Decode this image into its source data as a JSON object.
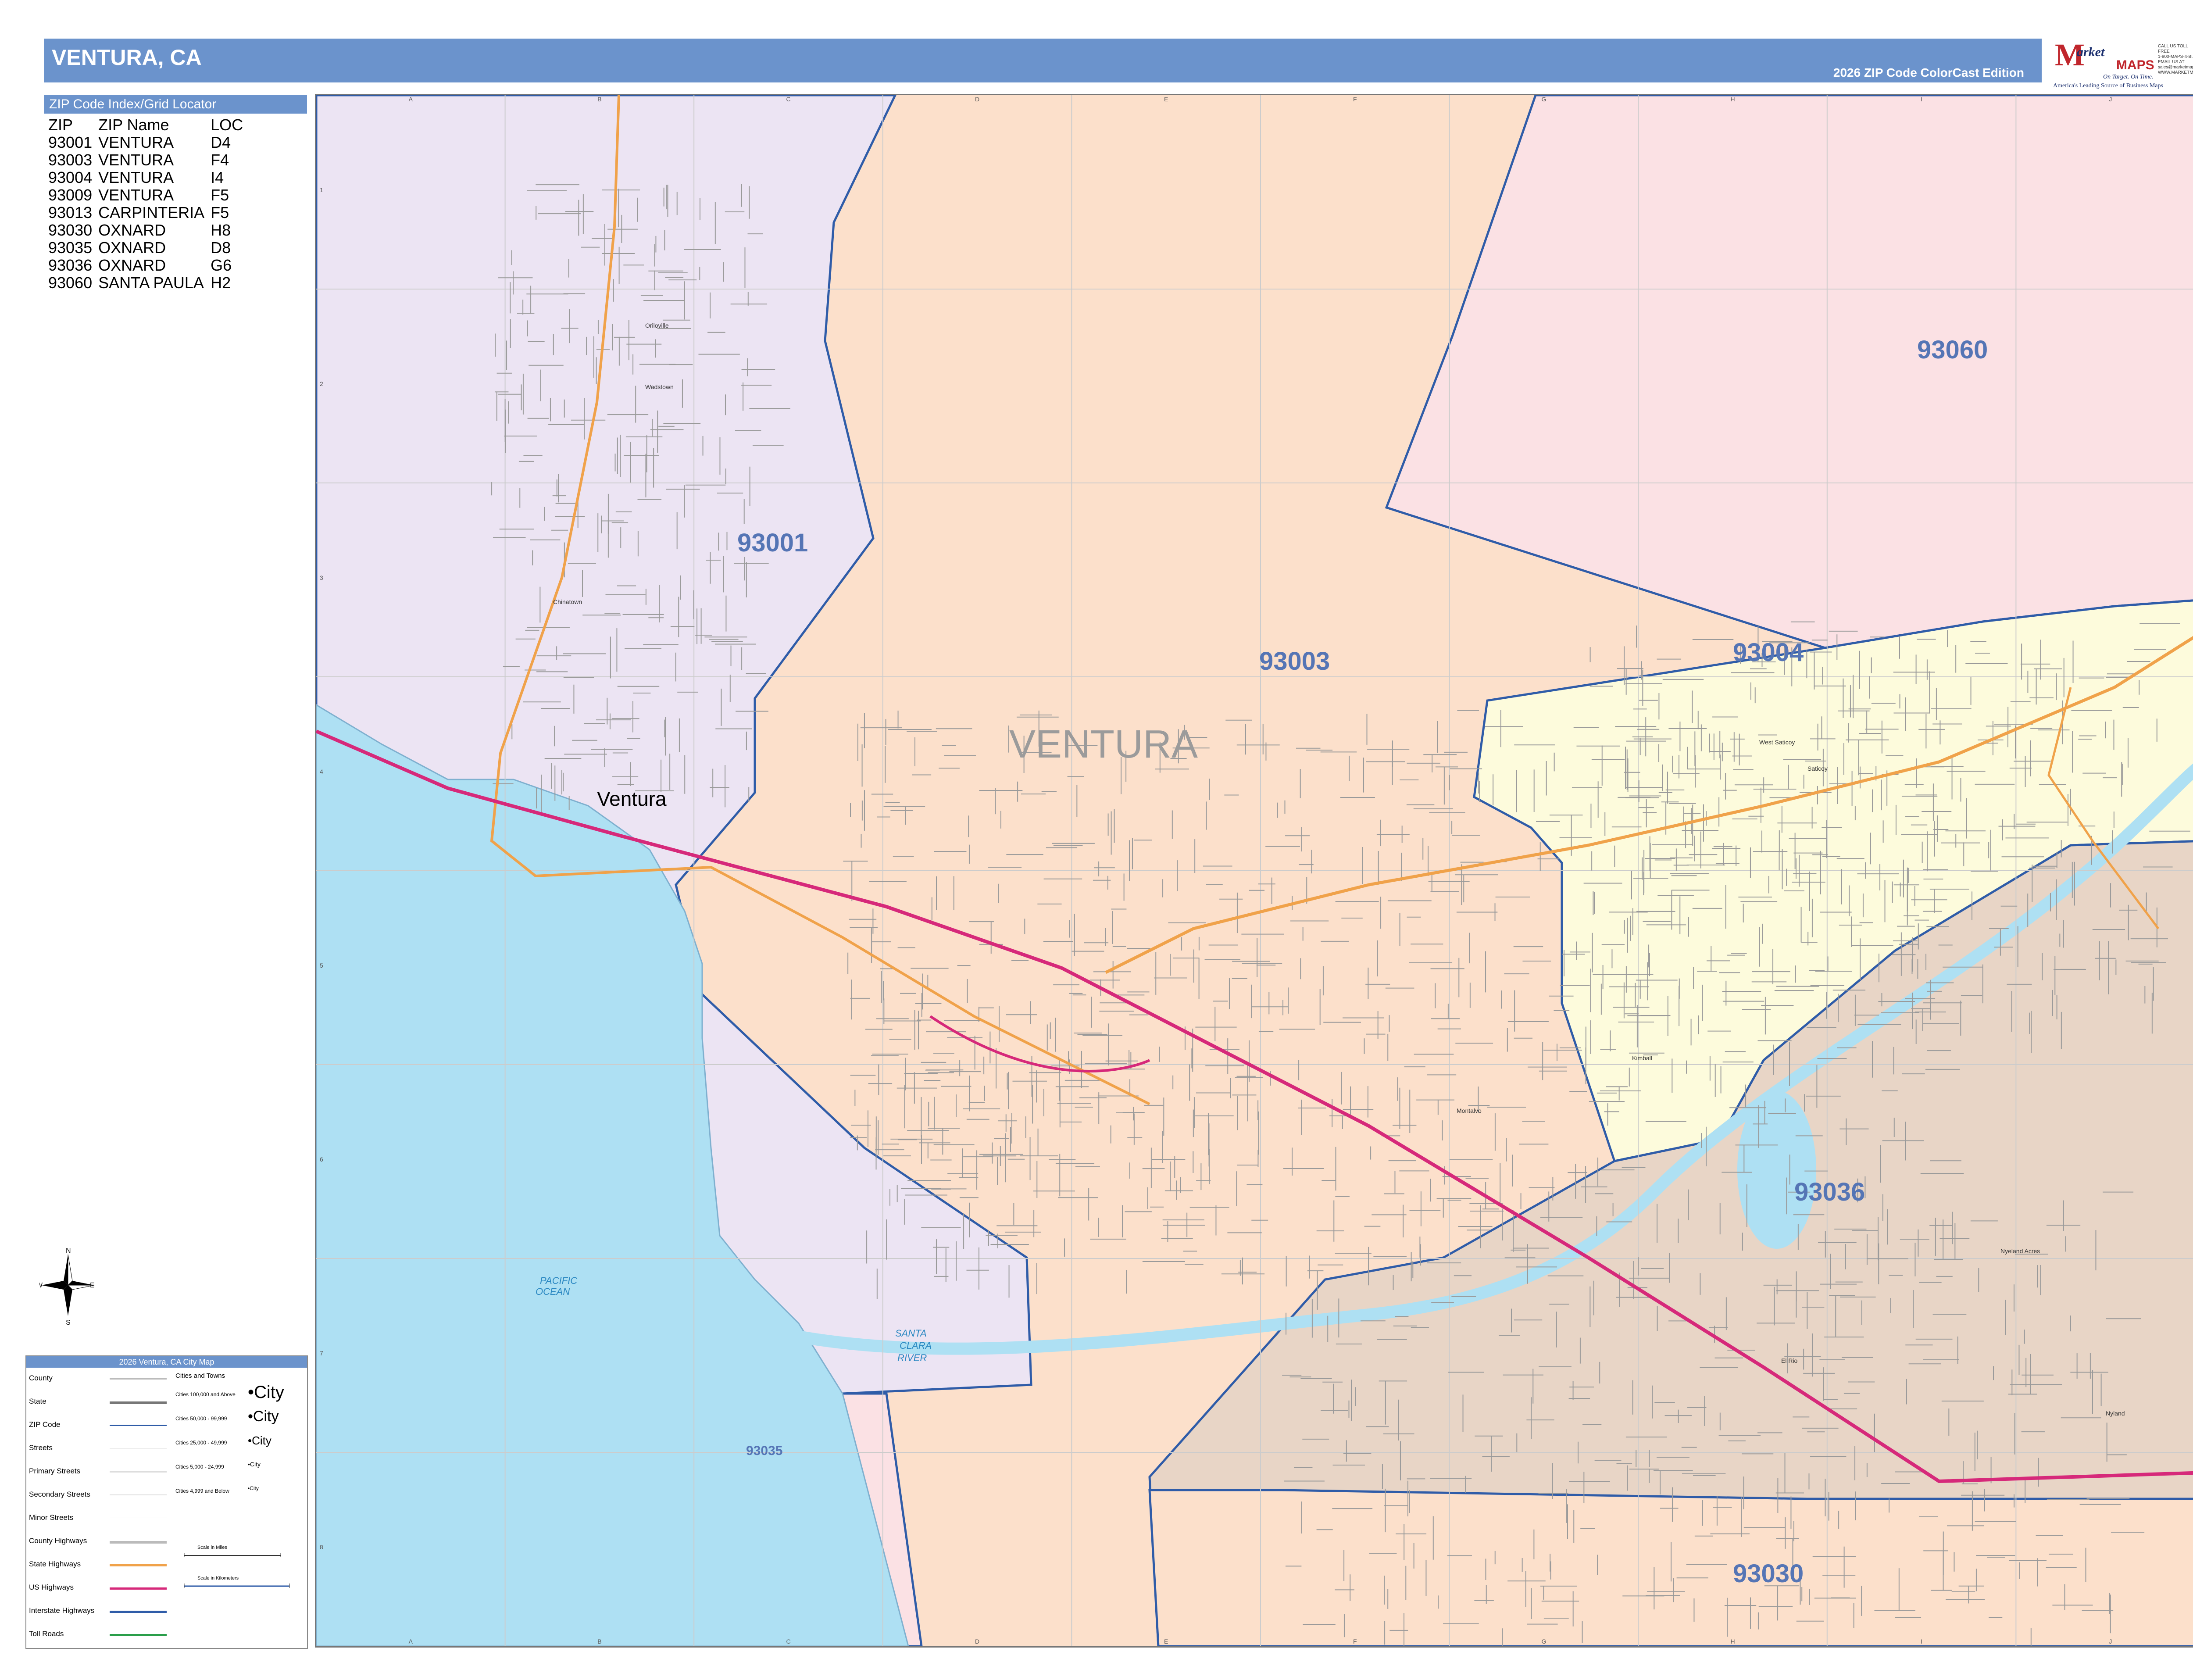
{
  "title": "VENTURA, CA",
  "edition": "2026 ZIP Code ColorCast Edition",
  "logo": {
    "m": "M",
    "market": "arket",
    "maps": "MAPS",
    "tagline": "On Target. On Time.",
    "subtag": "America's Leading Source of Business Maps",
    "contact": [
      "CALL US TOLL FREE",
      "1-800-MAPS-4-BIZ",
      "EMAIL US AT",
      "sales@marketmaps.com",
      "WWW.MARKETMAPS.COM"
    ]
  },
  "index": {
    "header": "ZIP Code Index/Grid Locator",
    "columns": [
      "ZIP",
      "ZIP Name",
      "LOC"
    ],
    "rows": [
      [
        "93001",
        "VENTURA",
        "D4"
      ],
      [
        "93003",
        "VENTURA",
        "F4"
      ],
      [
        "93004",
        "VENTURA",
        "I4"
      ],
      [
        "93009",
        "VENTURA",
        "F5"
      ],
      [
        "93013",
        "CARPINTERIA",
        "F5"
      ],
      [
        "93030",
        "OXNARD",
        "H8"
      ],
      [
        "93035",
        "OXNARD",
        "D8"
      ],
      [
        "93036",
        "OXNARD",
        "G6"
      ],
      [
        "93060",
        "SANTA PAULA",
        "H2"
      ]
    ]
  },
  "grid": {
    "columns": [
      "A",
      "B",
      "C",
      "D",
      "E",
      "F",
      "G",
      "H",
      "I",
      "J"
    ],
    "rows": [
      "1",
      "2",
      "3",
      "4",
      "5",
      "6",
      "7",
      "8"
    ]
  },
  "map": {
    "zip_labels": [
      "93001",
      "93003",
      "93004",
      "93060",
      "93036",
      "93030",
      "93035"
    ],
    "city_label": "VENTURA",
    "place_ventura": "Ventura",
    "water": [
      "PACIFIC",
      "OCEAN",
      "SANTA",
      "CLARA",
      "RIVER"
    ],
    "places": [
      "Oriloville",
      "Wadstown",
      "Chinatown",
      "West Saticoy",
      "Saticoy",
      "Montalvo",
      "Kimball",
      "El Rio",
      "Nyeland Acres",
      "Nyland"
    ],
    "colors": {
      "z93001": "#ece4f3",
      "z93003": "#fce0cb",
      "z93004": "#fdfbdc",
      "z93060": "#fbe1e4",
      "z93036": "#e8d5c6",
      "z93030": "#fce0cb",
      "z93035": "#fbe1e4",
      "ocean": "#aee0f3",
      "boundary": "#2f5ca8",
      "us_highway": "#d6297a",
      "state_highway": "#f0a24a",
      "zip_label": "#5575b5"
    }
  },
  "legend": {
    "title": "2026 Ventura, CA City Map",
    "items": [
      "County",
      "State",
      "ZIP Code",
      "Streets",
      "Primary Streets",
      "Secondary Streets",
      "Minor Streets",
      "County Highways",
      "State Highways",
      "US Highways",
      "Interstate Highways",
      "Toll Roads"
    ],
    "cities_head": "Cities and Towns",
    "city_classes": [
      "Cities 100,000 and Above",
      "Cities 50,000 - 99,999",
      "Cities 25,000 - 49,999",
      "Cities 5,000 - 24,999",
      "Cities 4,999 and Below"
    ],
    "city_sample": "City",
    "scale_miles": "Scale in Miles",
    "scale_km": "Scale in Kilometers"
  },
  "compass": [
    "N",
    "E",
    "S",
    "W"
  ]
}
